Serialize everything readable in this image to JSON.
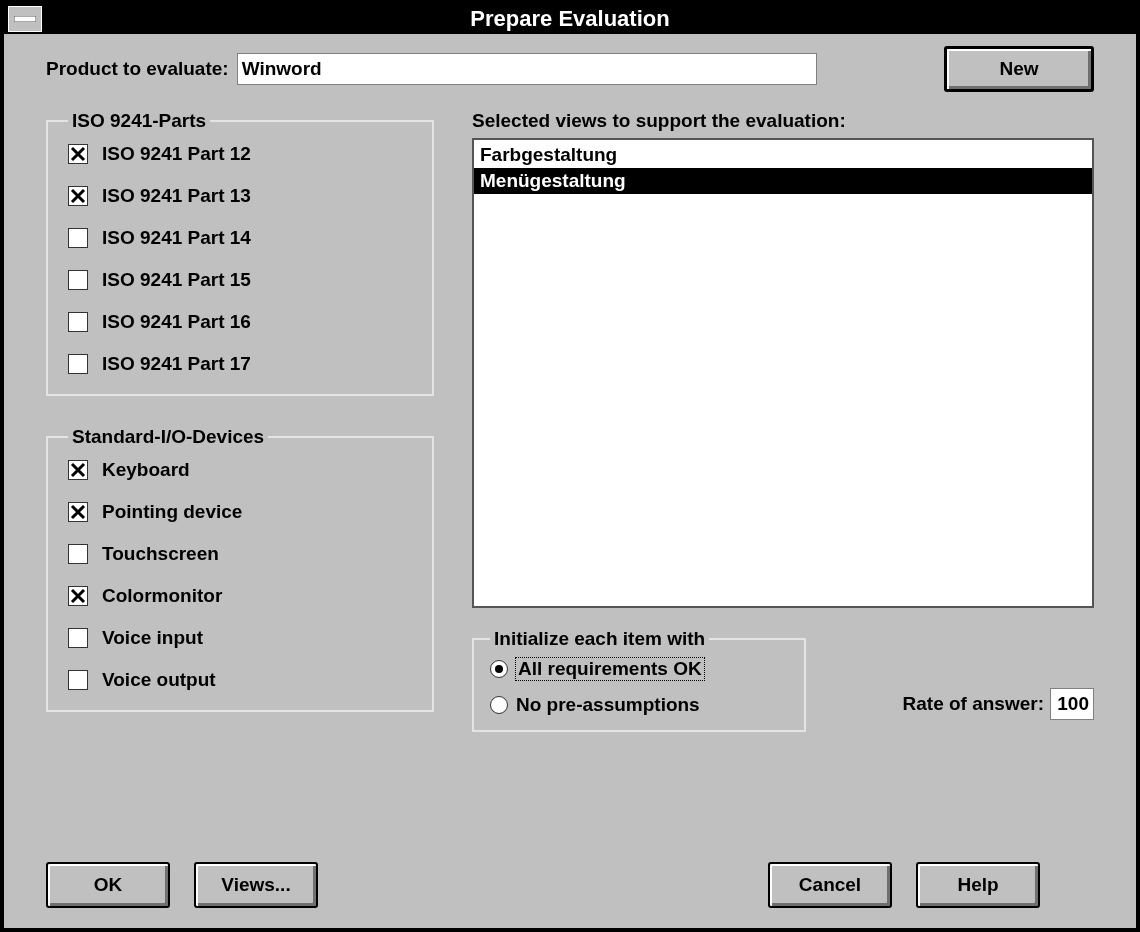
{
  "window": {
    "title": "Prepare Evaluation"
  },
  "product": {
    "label": "Product to evaluate:",
    "value": "Winword",
    "button": "New"
  },
  "iso_parts": {
    "title": "ISO 9241-Parts",
    "items": [
      {
        "label": "ISO 9241 Part 12",
        "checked": true
      },
      {
        "label": "ISO 9241 Part 13",
        "checked": true
      },
      {
        "label": "ISO 9241 Part 14",
        "checked": false
      },
      {
        "label": "ISO 9241 Part 15",
        "checked": false
      },
      {
        "label": "ISO 9241 Part 16",
        "checked": false
      },
      {
        "label": "ISO 9241 Part 17",
        "checked": false
      }
    ]
  },
  "io_devices": {
    "title": "Standard-I/O-Devices",
    "items": [
      {
        "label": "Keyboard",
        "checked": true
      },
      {
        "label": "Pointing device",
        "checked": true
      },
      {
        "label": "Touchscreen",
        "checked": false
      },
      {
        "label": "Colormonitor",
        "checked": true
      },
      {
        "label": "Voice input",
        "checked": false
      },
      {
        "label": "Voice output",
        "checked": false
      }
    ]
  },
  "views": {
    "label": "Selected views to support the evaluation:",
    "items": [
      {
        "label": "Farbgestaltung",
        "selected": false
      },
      {
        "label": "Menügestaltung",
        "selected": true
      }
    ]
  },
  "initialize": {
    "title": "Initialize each item with",
    "options": [
      {
        "label": "All requirements OK",
        "selected": true,
        "focused": true
      },
      {
        "label": "No pre-assumptions",
        "selected": false,
        "focused": false
      }
    ]
  },
  "rate": {
    "label": "Rate of answer:",
    "value": "100"
  },
  "left_buttons": [
    "OK",
    "Views..."
  ],
  "right_buttons": [
    "Cancel",
    "Help"
  ]
}
